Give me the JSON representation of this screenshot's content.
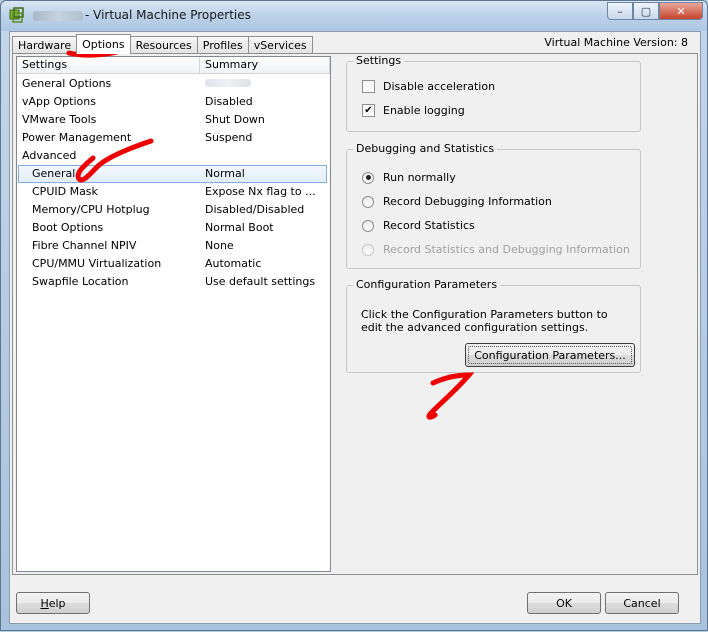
{
  "window": {
    "title": "- Virtual Machine Properties",
    "vm_version": "Virtual Machine Version: 8"
  },
  "controls": {
    "minimize": "–",
    "maximize": "▢",
    "close": "✕"
  },
  "tabs": [
    {
      "label": "Hardware"
    },
    {
      "label": "Options"
    },
    {
      "label": "Resources"
    },
    {
      "label": "Profiles"
    },
    {
      "label": "vServices"
    }
  ],
  "list": {
    "header_settings": "Settings",
    "header_summary": "Summary",
    "rows": [
      {
        "k": "General Options",
        "v": ""
      },
      {
        "k": "vApp Options",
        "v": "Disabled"
      },
      {
        "k": "VMware Tools",
        "v": "Shut Down"
      },
      {
        "k": "Power Management",
        "v": "Suspend"
      },
      {
        "k": "Advanced",
        "v": ""
      },
      {
        "k": "General",
        "v": "Normal"
      },
      {
        "k": "CPUID Mask",
        "v": "Expose Nx flag to ..."
      },
      {
        "k": "Memory/CPU Hotplug",
        "v": "Disabled/Disabled"
      },
      {
        "k": "Boot Options",
        "v": "Normal Boot"
      },
      {
        "k": "Fibre Channel NPIV",
        "v": "None"
      },
      {
        "k": "CPU/MMU Virtualization",
        "v": "Automatic"
      },
      {
        "k": "Swapfile Location",
        "v": "Use default settings"
      }
    ]
  },
  "settings_group": {
    "label": "Settings",
    "disable_acceleration": "Disable acceleration",
    "enable_logging": "Enable logging"
  },
  "debug_group": {
    "label": "Debugging and Statistics",
    "run_normally": "Run normally",
    "record_debug": "Record Debugging Information",
    "record_stats": "Record Statistics",
    "record_stats_debug": "Record Statistics and Debugging Information"
  },
  "config_group": {
    "label": "Configuration Parameters",
    "note": "Click the Configuration Parameters button to edit the advanced configuration settings.",
    "button": "Configuration Parameters..."
  },
  "footer": {
    "help_h": "H",
    "help_rest": "elp",
    "ok": "OK",
    "cancel": "Cancel"
  },
  "colors": {
    "annotation": "#ee0000",
    "selection_border": "#84acdd"
  }
}
